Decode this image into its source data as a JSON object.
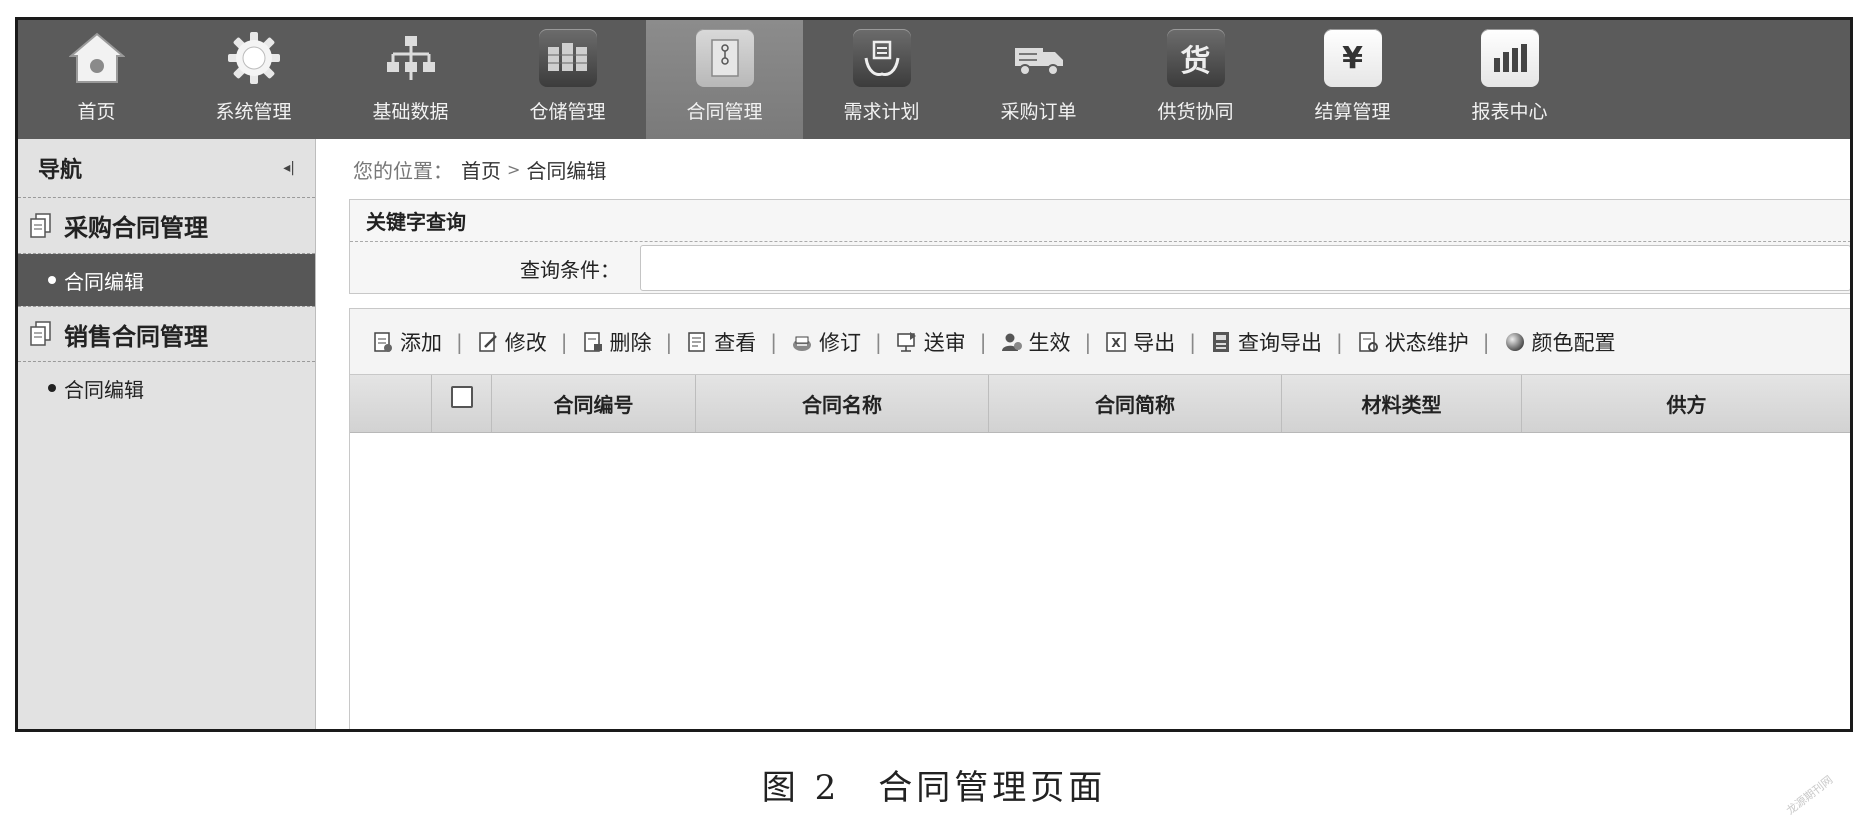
{
  "topnav": {
    "items": [
      {
        "label": "首页",
        "icon": "home-icon"
      },
      {
        "label": "系统管理",
        "icon": "gear-icon"
      },
      {
        "label": "基础数据",
        "icon": "hierarchy-icon"
      },
      {
        "label": "仓储管理",
        "icon": "warehouse-icon"
      },
      {
        "label": "合同管理",
        "icon": "contract-icon",
        "active": true
      },
      {
        "label": "需求计划",
        "icon": "demand-plan-icon"
      },
      {
        "label": "采购订单",
        "icon": "purchase-order-icon"
      },
      {
        "label": "供货协同",
        "icon": "supply-icon",
        "glyph": "货"
      },
      {
        "label": "结算管理",
        "icon": "settlement-icon",
        "glyph": "¥"
      },
      {
        "label": "报表中心",
        "icon": "report-chart-icon"
      }
    ]
  },
  "sidebar": {
    "title": "导航",
    "collapse_glyph": "◂|",
    "groups": [
      {
        "label": "采购合同管理",
        "items": [
          {
            "label": "合同编辑",
            "active": true
          }
        ]
      },
      {
        "label": "销售合同管理",
        "items": [
          {
            "label": "合同编辑",
            "active": false
          }
        ]
      }
    ]
  },
  "breadcrumb": {
    "prefix": "您的位置：",
    "home": "首页",
    "separator": ">",
    "current": "合同编辑"
  },
  "query": {
    "title": "关键字查询",
    "label": "查询条件：",
    "value": "",
    "placeholder": ""
  },
  "toolbar": {
    "buttons": [
      {
        "label": "添加",
        "icon": "add-doc-icon"
      },
      {
        "label": "修改",
        "icon": "edit-icon"
      },
      {
        "label": "删除",
        "icon": "delete-doc-icon"
      },
      {
        "label": "查看",
        "icon": "view-icon"
      },
      {
        "label": "修订",
        "icon": "revise-icon"
      },
      {
        "label": "送审",
        "icon": "submit-review-icon"
      },
      {
        "label": "生效",
        "icon": "user-activate-icon"
      },
      {
        "label": "导出",
        "icon": "excel-export-icon"
      },
      {
        "label": "查询导出",
        "icon": "query-export-icon"
      },
      {
        "label": "状态维护",
        "icon": "status-maintain-icon"
      },
      {
        "label": "颜色配置",
        "icon": "color-globe-icon"
      }
    ],
    "separator": "|"
  },
  "grid": {
    "columns": [
      "合同编号",
      "合同名称",
      "合同简称",
      "材料类型",
      "供方"
    ],
    "rows": []
  },
  "caption": "图 2　合同管理页面",
  "watermark": "龙源期刊网",
  "colors": {
    "topnav_bg": "#5b5b5b",
    "active_nav_bg": "#858585",
    "sidebar_bg": "#e2e2e2",
    "sidebar_active_bg": "#575757"
  }
}
